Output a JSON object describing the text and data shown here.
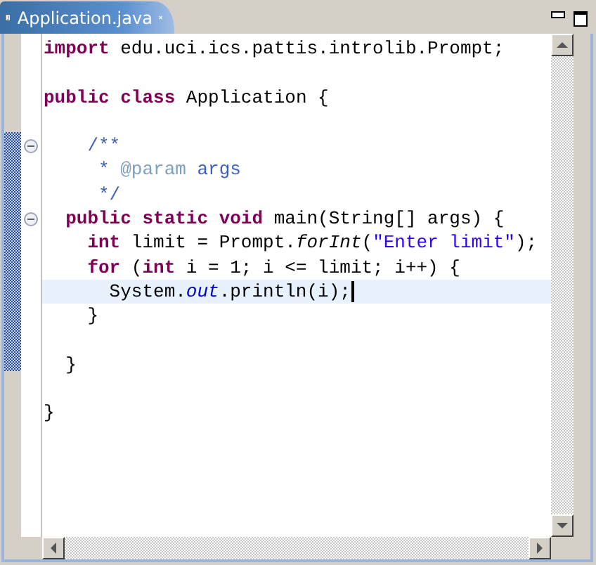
{
  "tab": {
    "title": "Application.java",
    "selected": true
  },
  "editor": {
    "lines": [
      {
        "kind": "code",
        "tokens": [
          {
            "kind": "keyword",
            "text": "import"
          },
          {
            "kind": "plain",
            "text": " edu.uci.ics.pattis.introlib.Prompt;"
          }
        ]
      },
      {
        "kind": "blank"
      },
      {
        "kind": "code",
        "tokens": [
          {
            "kind": "keyword",
            "text": "public class"
          },
          {
            "kind": "plain",
            "text": " Application {"
          }
        ]
      },
      {
        "kind": "blank"
      },
      {
        "kind": "code",
        "foldable": true,
        "tokens": [
          {
            "kind": "javadoc",
            "text": "    /**"
          }
        ]
      },
      {
        "kind": "code",
        "tokens": [
          {
            "kind": "javadoc",
            "text": "     * "
          },
          {
            "kind": "javadoc-tag",
            "text": "@param"
          },
          {
            "kind": "javadoc",
            "text": " args"
          }
        ]
      },
      {
        "kind": "code",
        "tokens": [
          {
            "kind": "javadoc",
            "text": "     */"
          }
        ]
      },
      {
        "kind": "code",
        "foldable": true,
        "tokens": [
          {
            "kind": "keyword",
            "text": "  public static void"
          },
          {
            "kind": "plain",
            "text": " main(String[] args) {"
          }
        ]
      },
      {
        "kind": "code",
        "tokens": [
          {
            "kind": "keyword",
            "text": "    int"
          },
          {
            "kind": "plain",
            "text": " limit = Prompt."
          },
          {
            "kind": "method-static",
            "text": "forInt"
          },
          {
            "kind": "plain",
            "text": "("
          },
          {
            "kind": "string",
            "text": "\"Enter limit\""
          },
          {
            "kind": "plain",
            "text": ");"
          }
        ]
      },
      {
        "kind": "code",
        "tokens": [
          {
            "kind": "keyword",
            "text": "    for"
          },
          {
            "kind": "plain",
            "text": " ("
          },
          {
            "kind": "keyword",
            "text": "int"
          },
          {
            "kind": "plain",
            "text": " i = 1; i <= limit; i++) {"
          }
        ]
      },
      {
        "kind": "code",
        "current": true,
        "tokens": [
          {
            "kind": "plain",
            "text": "      System."
          },
          {
            "kind": "static-field",
            "text": "out"
          },
          {
            "kind": "plain",
            "text": ".println(i);"
          }
        ]
      },
      {
        "kind": "code",
        "tokens": [
          {
            "kind": "plain",
            "text": "    }"
          }
        ]
      },
      {
        "kind": "blank"
      },
      {
        "kind": "code",
        "tokens": [
          {
            "kind": "plain",
            "text": "  }"
          }
        ]
      },
      {
        "kind": "blank"
      },
      {
        "kind": "code",
        "tokens": [
          {
            "kind": "plain",
            "text": "}"
          }
        ]
      }
    ]
  }
}
